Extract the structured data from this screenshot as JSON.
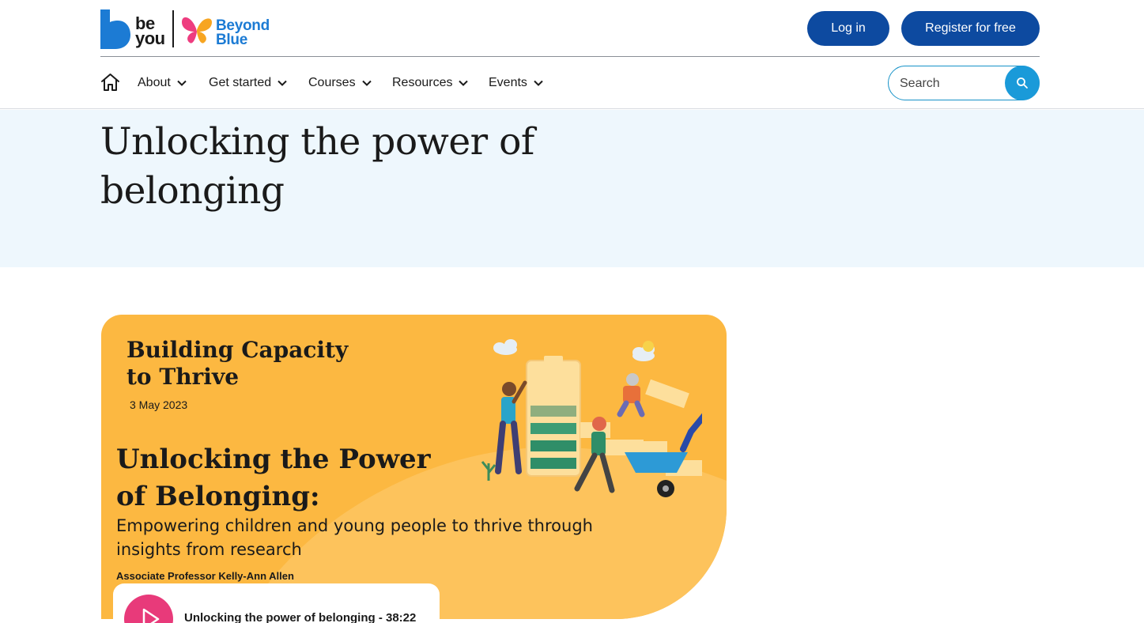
{
  "brand": {
    "beyou_top": "be",
    "beyou_bottom": "you",
    "beyond_top": "Beyond",
    "beyond_bottom": "Blue",
    "beyou_color": "#1c7bd4",
    "beyond_color": "#1c7bd4",
    "butterfly_pink": "#ee3d7f",
    "butterfly_orange": "#f7a521"
  },
  "header": {
    "login_label": "Log in",
    "register_label": "Register for free",
    "button_color": "#0d4aa0"
  },
  "nav": {
    "home_icon": "home-icon",
    "items": [
      {
        "label": "About"
      },
      {
        "label": "Get started"
      },
      {
        "label": "Courses"
      },
      {
        "label": "Resources"
      },
      {
        "label": "Events"
      }
    ],
    "chevron_icon": "chevron-down-icon"
  },
  "search": {
    "placeholder": "Search",
    "icon": "search-icon",
    "accent": "#1a9ad9"
  },
  "hero": {
    "title": "Unlocking the power of belonging",
    "background": "#eef7fd"
  },
  "video": {
    "event_name": "Building Capacity to Thrive",
    "date": "3 May 2023",
    "title": "Unlocking the Power of Belonging:",
    "subtitle": "Empowering children and young people to thrive through insights from research",
    "presenter": "Associate Professor Kelly-Ann Allen",
    "play_label": "Unlocking the power of belonging - 38:22",
    "play_icon": "play-icon",
    "card_color": "#fcb841",
    "play_color": "#e83a7a"
  }
}
